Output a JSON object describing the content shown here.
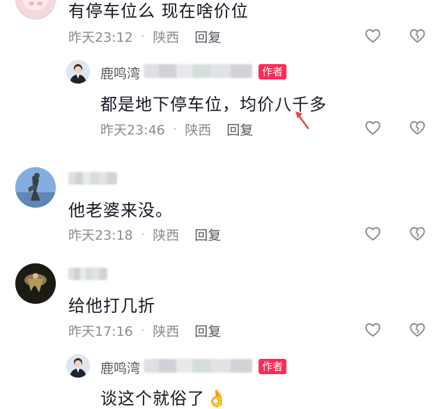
{
  "comments": [
    {
      "text": "有停车位么  现在啥价位",
      "time": "昨天23:12",
      "location": "陕西",
      "reply_label": "回复",
      "reply": {
        "name": "鹿鸣湾",
        "badge": "作者",
        "text": "都是地下停车位，均价八千多",
        "time": "昨天23:46",
        "location": "陕西",
        "reply_label": "回复"
      }
    },
    {
      "text": "他老婆来没。",
      "time": "昨天23:18",
      "location": "陕西",
      "reply_label": "回复"
    },
    {
      "text": "给他打几折",
      "time": "昨天17:16",
      "location": "陕西",
      "reply_label": "回复",
      "reply": {
        "name": "鹿鸣湾",
        "badge": "作者",
        "text": "谈这个就俗了",
        "emoji": "👌"
      }
    }
  ],
  "separator": "·",
  "colors": {
    "badge": "#fe2c55",
    "meta": "#8a8b91",
    "text": "#161823",
    "arrow": "#e8453c"
  },
  "icons": [
    "like-icon",
    "dislike-icon",
    "ok-hand-emoji"
  ]
}
